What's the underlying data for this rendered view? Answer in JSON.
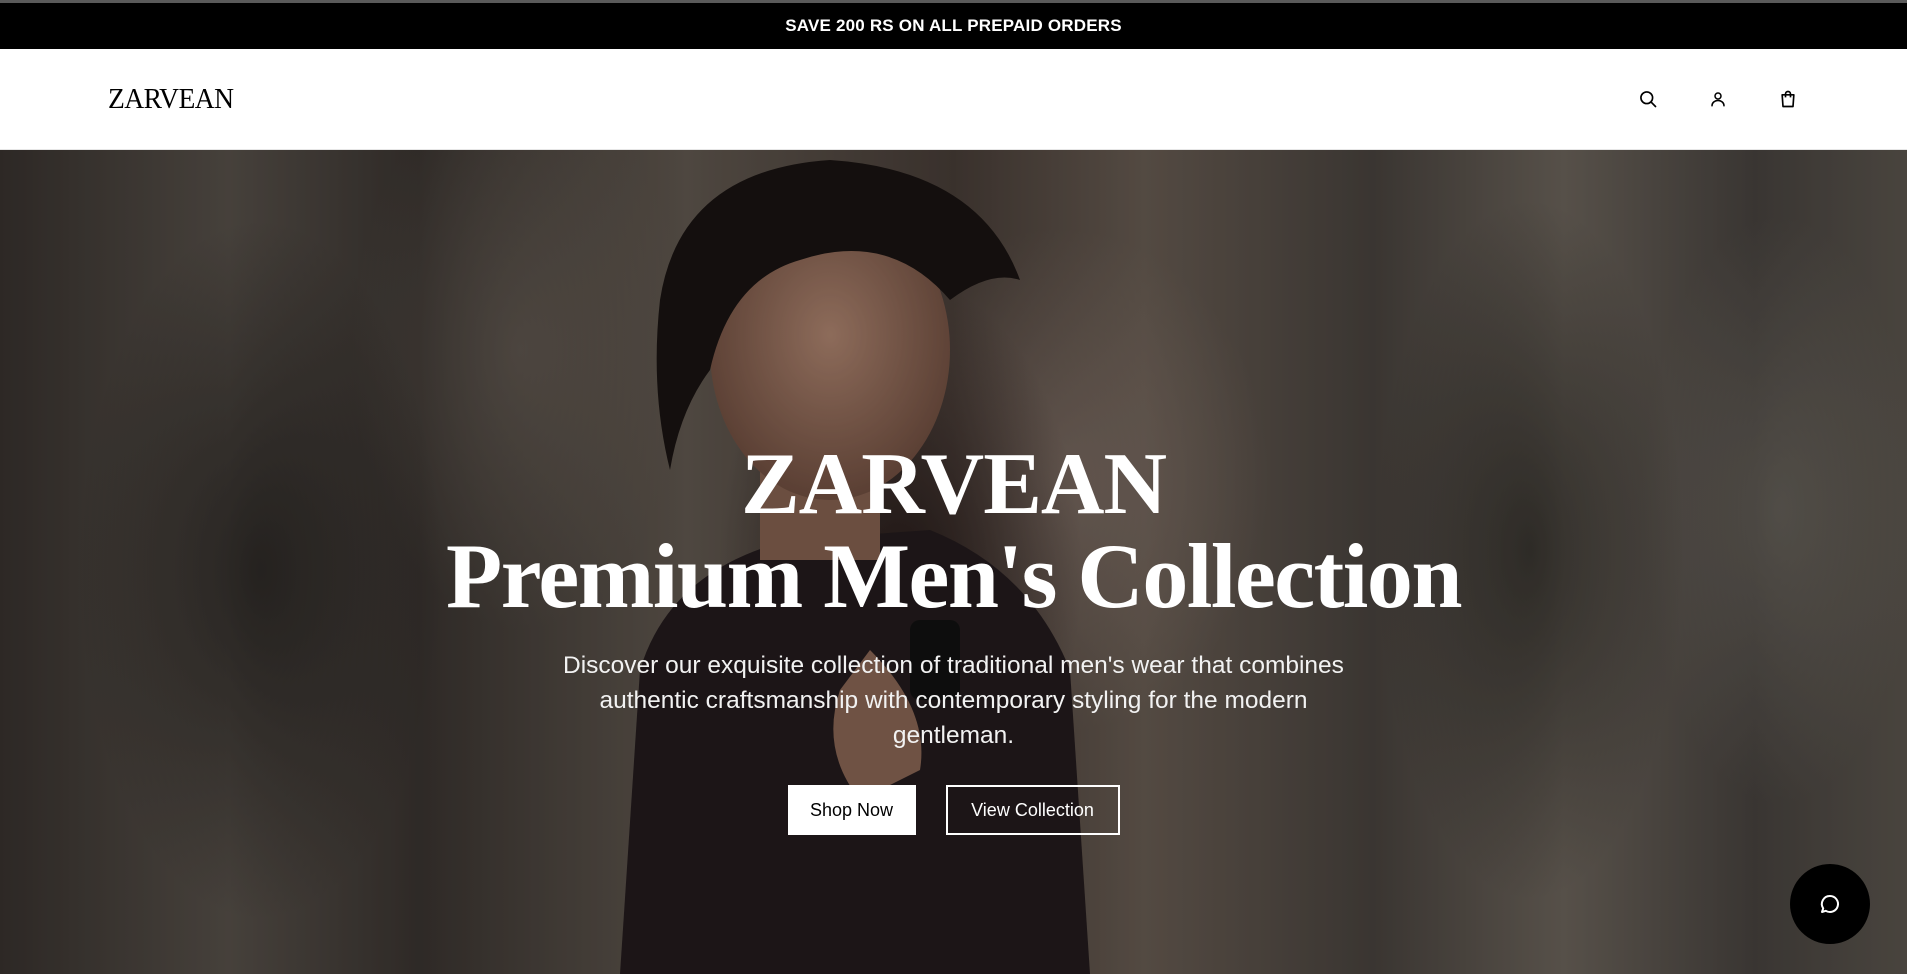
{
  "announcement": {
    "text": "SAVE 200 RS ON ALL PREPAID ORDERS"
  },
  "header": {
    "logo": "ZARVEAN",
    "icons": [
      "search-icon",
      "account-icon",
      "cart-icon"
    ]
  },
  "hero": {
    "brand": "ZARVEAN",
    "title": "Premium Men's Collection",
    "description": "Discover our exquisite collection of traditional men's wear that combines authentic craftsmanship with contemporary styling for the modern gentleman.",
    "primary_button": "Shop Now",
    "secondary_button": "View Collection"
  },
  "chat": {
    "icon": "chat-bubble-icon"
  },
  "colors": {
    "announcement_bg": "#000000",
    "header_bg": "#ffffff",
    "text_light": "#ffffff",
    "chat_bg": "#000000"
  }
}
